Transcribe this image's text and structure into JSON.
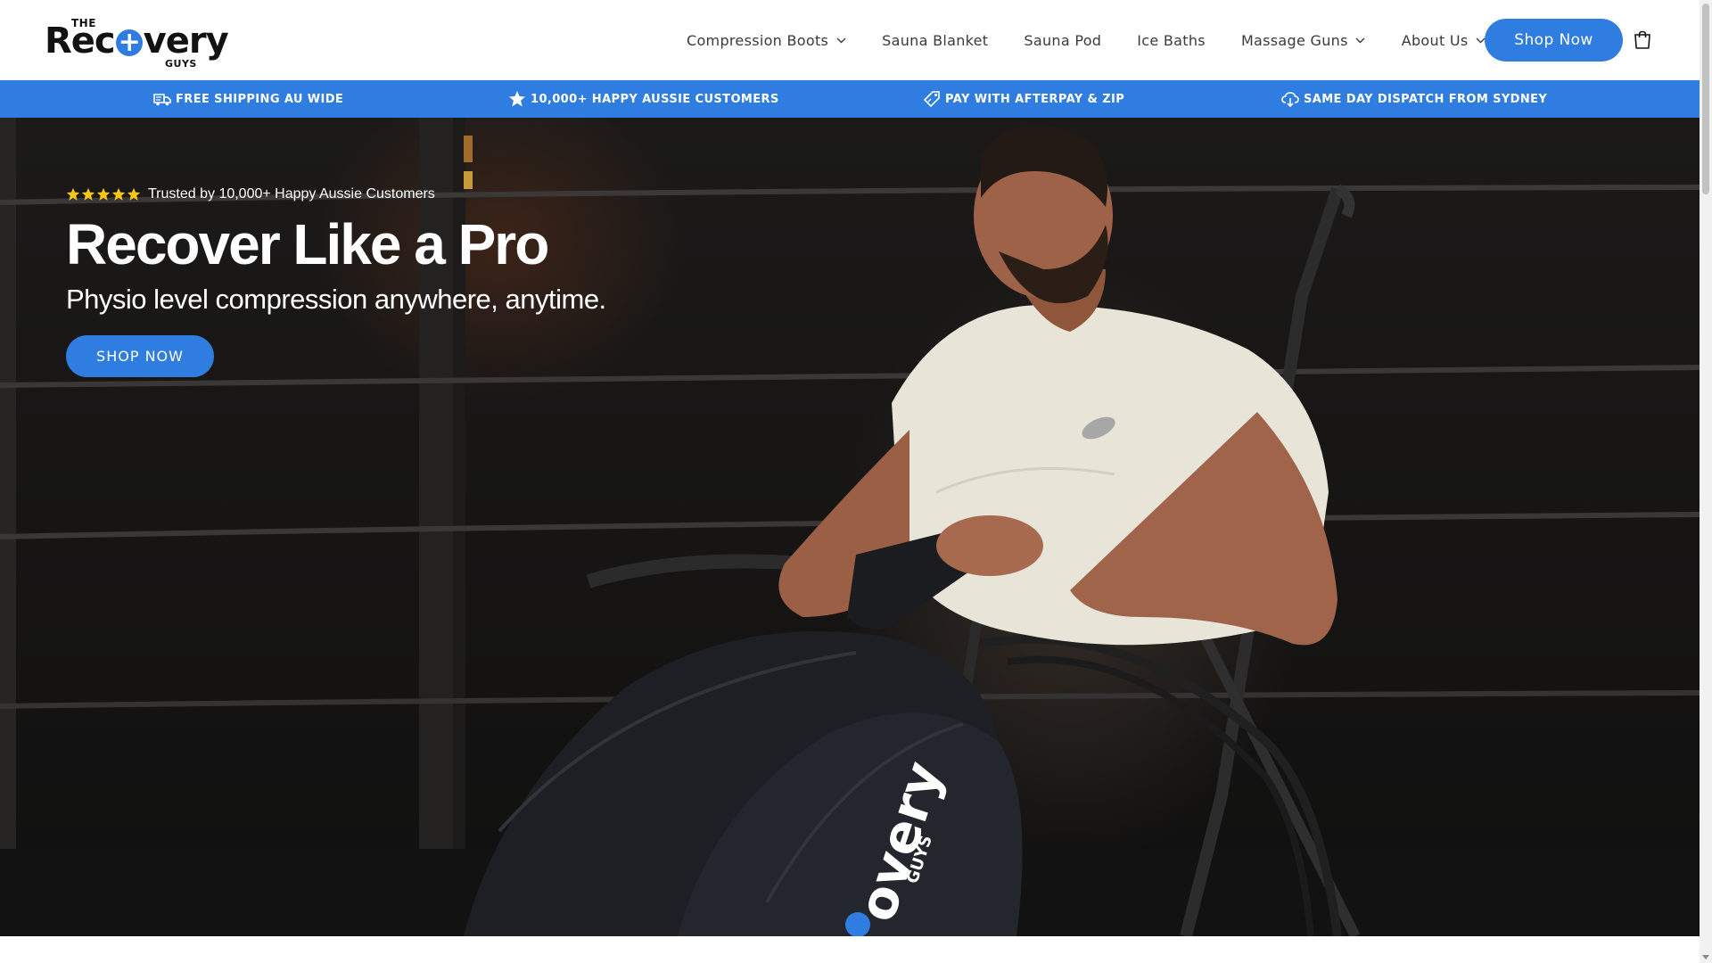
{
  "header": {
    "logo": {
      "the": "THE",
      "word_left": "Rec",
      "word_right": "very",
      "guys": "GUYS"
    },
    "nav": [
      {
        "label": "Compression Boots",
        "dropdown": true
      },
      {
        "label": "Sauna Blanket",
        "dropdown": false
      },
      {
        "label": "Sauna Pod",
        "dropdown": false
      },
      {
        "label": "Ice Baths",
        "dropdown": false
      },
      {
        "label": "Massage Guns",
        "dropdown": true
      },
      {
        "label": "About Us",
        "dropdown": true
      }
    ],
    "cta_label": "Shop Now",
    "cart_icon": "cart-icon"
  },
  "announcement": {
    "items": [
      {
        "icon": "truck-icon",
        "label": "FREE SHIPPING AU WIDE"
      },
      {
        "icon": "star-icon",
        "label": "10,000+ HAPPY AUSSIE CUSTOMERS"
      },
      {
        "icon": "payment-tag-icon",
        "label": "PAY WITH AFTERPAY & ZIP"
      },
      {
        "icon": "cloud-dispatch-icon",
        "label": "SAME DAY DISPATCH FROM SYDNEY"
      }
    ]
  },
  "hero": {
    "rating_stars": 5,
    "rating_text": "Trusted by 10,000+ Happy Aussie Customers",
    "title": "Recover Like a Pro",
    "subtitle": "Physio level compression anywhere, anytime.",
    "cta_label": "SHOP NOW",
    "boot_brand": "overy",
    "boot_brand_sub": "GUYS"
  },
  "colors": {
    "accent": "#2f7de1",
    "star": "#f5c518",
    "header_bg": "#ffffff",
    "hero_text": "#ffffff"
  }
}
